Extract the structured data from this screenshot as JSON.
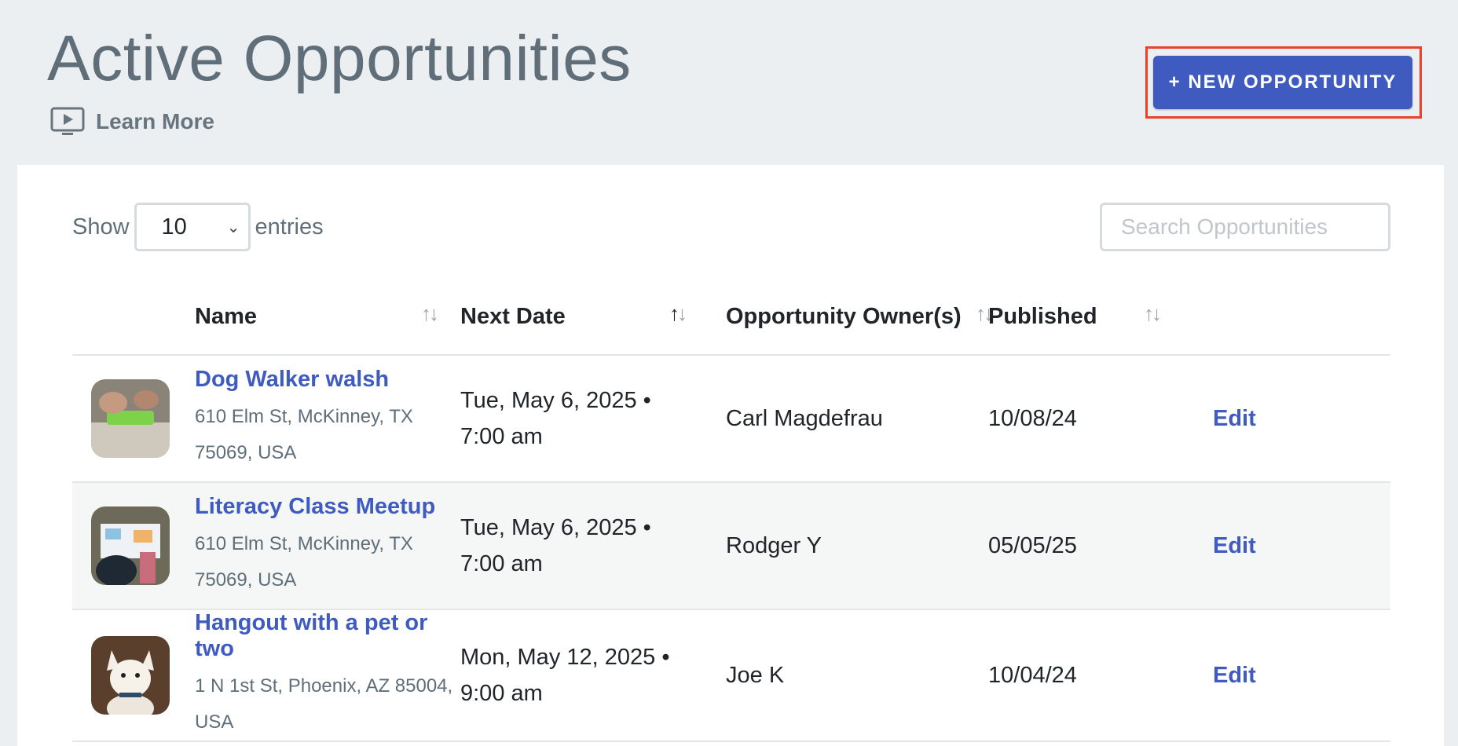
{
  "header": {
    "title": "Active Opportunities",
    "learn_more": "Learn More",
    "new_button": "+ NEW OPPORTUNITY"
  },
  "controls": {
    "show_label": "Show",
    "entries_value": "10",
    "entries_label": "entries",
    "search_placeholder": "Search Opportunities"
  },
  "table": {
    "columns": [
      "Name",
      "Next Date",
      "Opportunity Owner(s)",
      "Published"
    ],
    "rows": [
      {
        "name": "Dog Walker walsh",
        "address_line1": "610 Elm St, McKinney, TX",
        "address_line2": "75069, USA",
        "next_date_line1": "Tue, May 6, 2025 •",
        "next_date_line2": "7:00 am",
        "owner": "Carl Magdefrau",
        "published": "10/08/24",
        "edit": "Edit"
      },
      {
        "name": "Literacy Class Meetup",
        "address_line1": "610 Elm St, McKinney, TX",
        "address_line2": "75069, USA",
        "next_date_line1": "Tue, May 6, 2025 •",
        "next_date_line2": "7:00 am",
        "owner": "Rodger Y",
        "published": "05/05/25",
        "edit": "Edit"
      },
      {
        "name": "Hangout with a pet or two",
        "address_line1": "1 N 1st St, Phoenix, AZ 85004,",
        "address_line2": "USA",
        "next_date_line1": "Mon, May 12, 2025 •",
        "next_date_line2": "9:00 am",
        "owner": "Joe K",
        "published": "10/04/24",
        "edit": "Edit"
      }
    ]
  },
  "colors": {
    "accent": "#3f5bbf",
    "highlight_frame": "#e8432a",
    "background": "#ebeff2"
  }
}
